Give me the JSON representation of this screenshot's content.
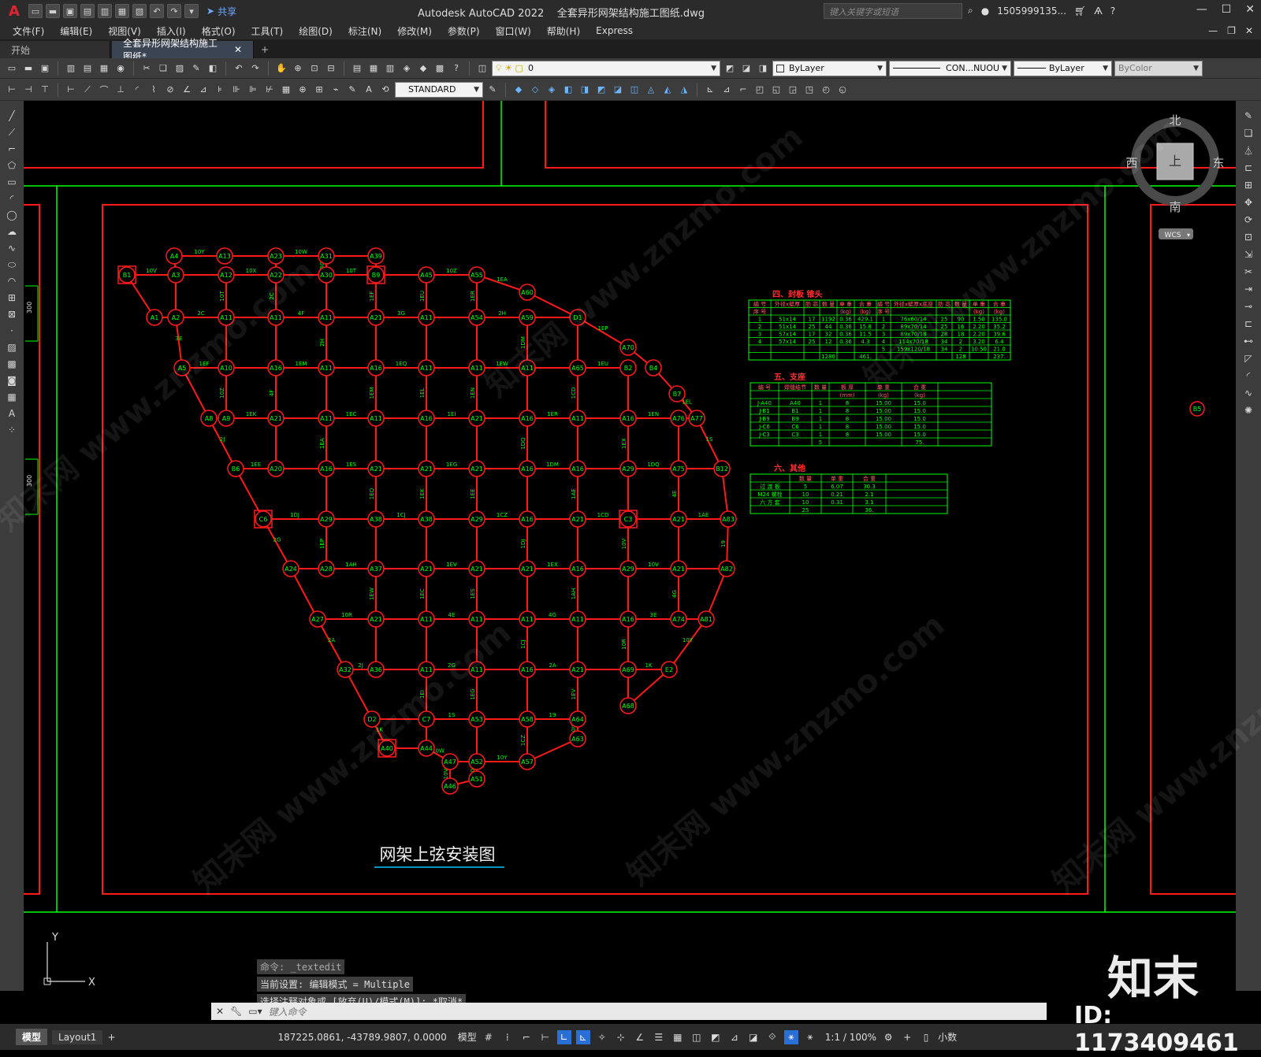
{
  "app": {
    "title": "Autodesk AutoCAD 2022",
    "file": "全套异形网架结构施工图纸.dwg",
    "share": "共享",
    "search_placeholder": "键入关键字或短语",
    "user": "1505999135...",
    "logo": "A"
  },
  "menus": [
    "文件(F)",
    "编辑(E)",
    "视图(V)",
    "插入(I)",
    "格式(O)",
    "工具(T)",
    "绘图(D)",
    "标注(N)",
    "修改(M)",
    "参数(P)",
    "窗口(W)",
    "帮助(H)",
    "Express"
  ],
  "tabs": [
    {
      "label": "开始"
    },
    {
      "label": "全套异形网架结构施工图纸*"
    }
  ],
  "properties": {
    "layer": "0",
    "color": "ByLayer",
    "linetype": "CON...NUOU",
    "lineweight": "ByLayer",
    "plotstyle": "ByColor",
    "textstyle": "STANDARD"
  },
  "viewcube": {
    "north": "北",
    "south": "南",
    "east": "东",
    "west": "西",
    "face": "上",
    "wcs": "WCS"
  },
  "drawing": {
    "title": "网架上弦安装图",
    "left_dims": [
      "300",
      "300"
    ],
    "edge_node": "B5",
    "table1": {
      "title": "四、封板 锥头",
      "header1": [
        "编 号",
        "外径x壁厚",
        "肋 高",
        "数 量",
        "单 重",
        "合 重",
        "编 号",
        "外径x壁厚x底座",
        "肋 高",
        "数 量",
        "单 重",
        "合 重"
      ],
      "header2": [
        "序 号",
        "",
        "",
        "",
        "(kg)",
        "(kg)",
        "序 号",
        "",
        "",
        "",
        "(kg)",
        "(kg)"
      ],
      "rows": [
        [
          "1",
          "51x14",
          "17",
          "1192",
          "0.36",
          "429.1",
          "1",
          "76x60/14",
          "25",
          "90",
          "1.50",
          "135.0"
        ],
        [
          "2",
          "51x14",
          "25",
          "44",
          "0.36",
          "15.8",
          "2",
          "89x70/14",
          "25",
          "16",
          "2.20",
          "35.2"
        ],
        [
          "3",
          "57x14",
          "17",
          "32",
          "0.36",
          "11.5",
          "3",
          "89x70/18",
          "28",
          "18",
          "2.20",
          "39.6"
        ],
        [
          "4",
          "57x14",
          "25",
          "12",
          "0.36",
          "4.3",
          "4",
          "114x70/18",
          "34",
          "2",
          "3.20",
          "6.4"
        ],
        [
          "",
          "",
          "",
          "",
          "",
          "",
          "5",
          "159x120/18",
          "34",
          "2",
          "10.50",
          "21.0"
        ],
        [
          "",
          "",
          "",
          "1280",
          "",
          "461.",
          "",
          "",
          "",
          "128",
          "",
          "237."
        ]
      ]
    },
    "table2": {
      "title": "五、支座",
      "header1": [
        "编 号",
        "焊缝结节",
        "数 量",
        "板 厚",
        "单 重",
        "合 重"
      ],
      "header2": [
        "",
        "",
        "",
        "(mm)",
        "(kg)",
        "(kg)"
      ],
      "rows": [
        [
          "J-A40",
          "A40",
          "1",
          "8",
          "15.00",
          "15.0"
        ],
        [
          "J-B1",
          "B1",
          "1",
          "8",
          "15.00",
          "15.0"
        ],
        [
          "J-B9",
          "B9",
          "1",
          "8",
          "15.00",
          "15.0"
        ],
        [
          "J-C6",
          "C6",
          "1",
          "8",
          "15.00",
          "15.0"
        ],
        [
          "J-C3",
          "C3",
          "1",
          "8",
          "15.00",
          "15.0"
        ],
        [
          "",
          "",
          "5",
          "",
          "",
          "75."
        ]
      ]
    },
    "table3": {
      "title": "六、其他",
      "header1": [
        "",
        "数 量",
        "单 重",
        "合 重"
      ],
      "rows": [
        [
          "过 渡 板",
          "5",
          "6.07",
          "30.3"
        ],
        [
          "M24 螺栓",
          "10",
          "0.21",
          "2.1"
        ],
        [
          "六 方 套",
          "10",
          "0.31",
          "3.1"
        ],
        [
          "",
          "25",
          "",
          "36."
        ]
      ]
    },
    "nodes": {
      "row1": [
        "A4",
        "A13",
        "A23",
        "A31",
        "A39"
      ],
      "row2": [
        "B1",
        "A3",
        "A12",
        "A22",
        "A30",
        "B9",
        "A45",
        "A55"
      ],
      "row3": [
        "A1",
        "A2",
        "A11",
        "A11",
        "A11",
        "A21",
        "A11",
        "A54",
        "A59",
        "D1",
        "A60",
        "A70"
      ],
      "row4": [
        "A5",
        "A10",
        "A16",
        "A11",
        "A16",
        "A11",
        "A11",
        "A11",
        "A65",
        "B2",
        "B4"
      ],
      "row5": [
        "A8",
        "A9",
        "A21",
        "A11",
        "A11",
        "A16",
        "A21",
        "A16",
        "A11",
        "A16",
        "A76",
        "A77",
        "B7"
      ],
      "row6": [
        "B6",
        "A20",
        "A16",
        "A21",
        "A21",
        "A21",
        "A16",
        "A16",
        "A29",
        "A75",
        "B12"
      ],
      "row7": [
        "C6",
        "A29",
        "A38",
        "A38",
        "A29",
        "A16",
        "A21",
        "C3",
        "A21",
        "A83"
      ],
      "row8": [
        "A24",
        "A28",
        "A37",
        "A21",
        "A21",
        "A21",
        "A16",
        "A29",
        "A21",
        "A82"
      ],
      "row9": [
        "A27",
        "A21",
        "A11",
        "A11",
        "A11",
        "A11",
        "A16",
        "A74",
        "A81"
      ],
      "row10": [
        "A32",
        "A36",
        "A11",
        "A11",
        "A16",
        "A21",
        "A69",
        "E2"
      ],
      "row11": [
        "D2",
        "C7",
        "A53",
        "A58",
        "A64",
        "A68"
      ],
      "row12": [
        "A40",
        "A44",
        "A47",
        "A52",
        "A57",
        "A63"
      ],
      "row13": [
        "A46",
        "A51"
      ]
    },
    "edge_labels": [
      "10Y",
      "10W",
      "10V",
      "10X",
      "10T",
      "10Z",
      "2C",
      "4F",
      "3G",
      "2H",
      "1EA",
      "1EP",
      "1EF",
      "1EM",
      "1EQ",
      "1EW",
      "1EU",
      "1EL",
      "1EK",
      "1EC",
      "1EI",
      "1ER",
      "1EN",
      "1EE",
      "1ES",
      "1EG",
      "1DM",
      "1DQ",
      "1DJ",
      "1CJ",
      "1CZ",
      "1CD",
      "1AE",
      "1AH",
      "1EV",
      "1EX",
      "10V",
      "10R",
      "4E",
      "4G",
      "3E",
      "2J",
      "2G",
      "2A",
      "1K",
      "1S",
      "19"
    ]
  },
  "command": {
    "history": [
      "命令: _textedit",
      "当前设置: 编辑模式 = Multiple",
      "选择注释对象或 [放弃(U)/模式(M)]: *取消*"
    ],
    "placeholder": "键入命令"
  },
  "status": {
    "layouts": [
      "模型",
      "Layout1"
    ],
    "coords": "187225.0861, -43789.9807, 0.0000",
    "space": "模型",
    "scale": "1:1 / 100%",
    "units": "小数"
  },
  "ucs": {
    "y": "Y",
    "x": "X"
  },
  "watermark": {
    "brand": "知末",
    "id": "ID: 1173409461",
    "site": "知末网 www.znzmo.com"
  },
  "colors": {
    "red": "#ff1a1a",
    "green": "#00ff00",
    "bg": "#000000",
    "accent": "#2a6fd6"
  }
}
